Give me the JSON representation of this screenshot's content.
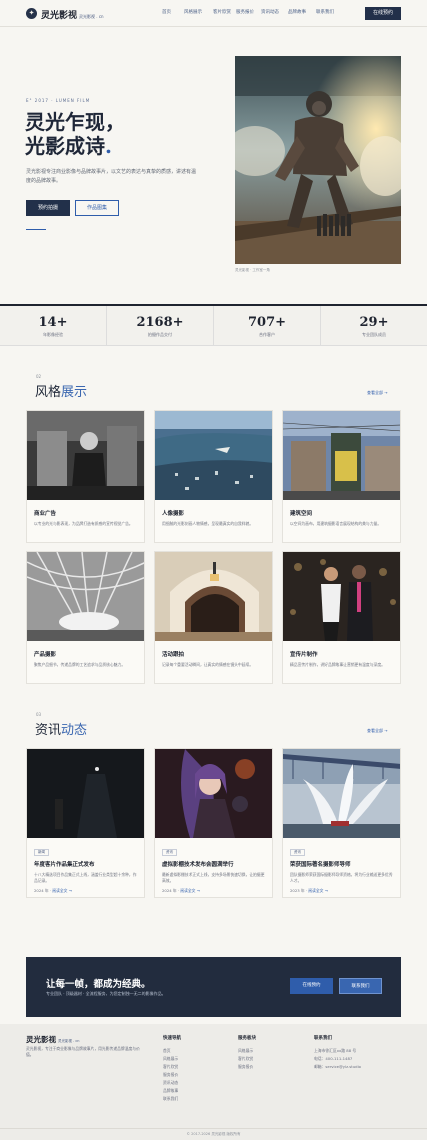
{
  "header": {
    "logo_mark": "✦",
    "logo_text": "灵光影视",
    "logo_sub": "灵光影视 . cn",
    "nav": [
      "首页",
      "风格展示",
      "客片欣赏",
      "服务报价",
      "资讯动态",
      "品牌故事",
      "联系我们"
    ],
    "cta": "在线预约"
  },
  "hero": {
    "kicker": "E° 2017 · LUMEN FILM",
    "title_line1": "灵光乍现，",
    "title_line2": "光影成诗",
    "title_dot": ".",
    "desc": "灵光影视专注商业影像与品牌故事片，以文艺的表达与真挚的质感，讲述有温度的品牌故事。",
    "btn_primary": "预约拍摄",
    "btn_secondary": "作品图集",
    "caption": "灵光影视 · 工作室一角"
  },
  "stats": [
    {
      "num": "14+",
      "label": "年影像经验"
    },
    {
      "num": "2168+",
      "label": "拍摄作品交付"
    },
    {
      "num": "707+",
      "label": "合作客户"
    },
    {
      "num": "29+",
      "label": "专业团队成员"
    }
  ],
  "styles": {
    "mark": "02",
    "title_main": "风格",
    "title_accent": "展示",
    "more": "查看全部 →",
    "cards": [
      {
        "title": "商业广告",
        "desc": "以专业的光与影表现，为品牌打造有质感的宣传视觉广告。"
      },
      {
        "title": "人像摄影",
        "desc": "用细腻的光影刻画人物情感，呈现最真实的自我样貌。"
      },
      {
        "title": "建筑空间",
        "desc": "以空间为画布，用建筑摄影语言展现结构的美与力量。"
      },
      {
        "title": "产品摄影",
        "desc": "聚焦产品细节，传递品牌的工艺追求与品质核心魅力。"
      },
      {
        "title": "活动跟拍",
        "desc": "记录每个重要活动瞬间，让真实的情感在镜头中延续。"
      },
      {
        "title": "宣传片制作",
        "desc": "精品宣传片制作，讲好品牌故事让营销更有温度与深度。"
      }
    ]
  },
  "news": {
    "mark": "03",
    "title_main": "资讯",
    "title_accent": "动态",
    "more": "查看全部 →",
    "items": [
      {
        "tag": "新闻",
        "title": "年度客片作品集正式发布",
        "desc": "十八大精选项目作品集正式上线，涵盖行业类型超十余种，作品记录。",
        "date": "2024 年",
        "link": "阅读全文 →"
      },
      {
        "tag": "资讯",
        "title": "虚拟影棚技术发布会圆满举行",
        "desc": "最新虚拟影棚技术正式上线，支持多场景快速切换，让拍摄更高效。",
        "date": "2024 年",
        "link": "阅读全文 →"
      },
      {
        "tag": "资讯",
        "title": "荣获国际著名摄影师导师",
        "desc": "团队摄影师荣获国际摄影师导师资格，将为行业输送更多优秀人才。",
        "date": "2023 年",
        "link": "阅读全文 →"
      }
    ]
  },
  "banner": {
    "title": "让每一帧，都成为经典。",
    "sub": "专业团队 · 顶级器材 · 全流程服务，为您定制独一无二的影像作品。",
    "btn1": "在线预约",
    "btn2": "联系我们"
  },
  "footer": {
    "logo": "灵光影视",
    "logo_sub": "灵光影视 . cn",
    "desc": "灵光影视，专注于商业影像与品牌故事片，用光影传递品牌温度与价值。",
    "col1": {
      "title": "快速导航",
      "items": [
        "首页",
        "风格展示",
        "客片欣赏",
        "服务报价",
        "资讯动态",
        "品牌故事",
        "联系我们"
      ]
    },
    "col2": {
      "title": "服务板块",
      "items": [
        "风格展示",
        "客片欣赏",
        "服务报价"
      ]
    },
    "col3": {
      "title": "联系我们",
      "items": [
        "上海市徐汇区xx路 88 号",
        "电话：400-111-1487",
        "邮箱：service@ylz.studio"
      ]
    },
    "copyright": "© 2017-2026 灵光影视 版权所有"
  }
}
